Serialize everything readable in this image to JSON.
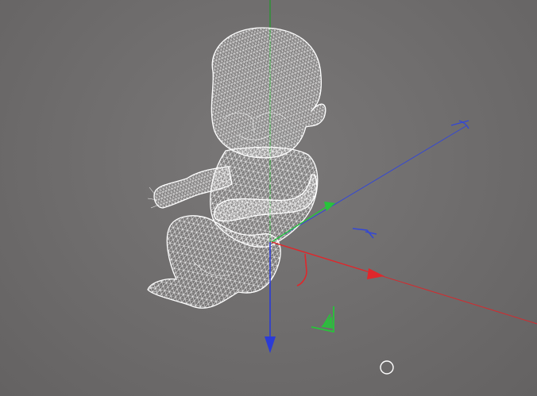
{
  "viewport": {
    "background_color": "#6f6d6d",
    "object": "wireframe-baby-model",
    "wire_color": "#f4f4f4"
  },
  "gizmo": {
    "x_axis_color": "#e0272b",
    "y_axis_color": "#27c43a",
    "z_axis_color": "#2b3bd6",
    "grid_y_line_color": "#1f9a2a"
  },
  "cursor": {
    "shape": "circle",
    "color": "#ffffff"
  }
}
